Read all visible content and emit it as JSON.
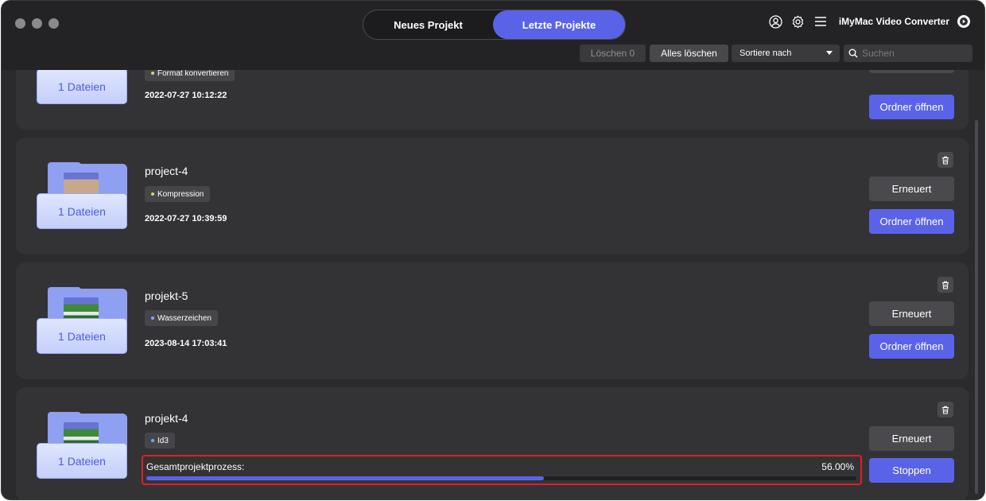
{
  "header": {
    "tabs": [
      {
        "label": "Neues Projekt",
        "active": false
      },
      {
        "label": "Letzte Projekte",
        "active": true
      }
    ],
    "app_name": "iMyMac Video Converter",
    "icons": [
      "user-icon",
      "gear-icon",
      "menu-icon",
      "app-logo-icon"
    ]
  },
  "toolbar": {
    "clear_label": "Löschen 0",
    "clear_all_label": "Alles löschen",
    "sort_label": "Sortiere nach",
    "search_placeholder": "Suchen"
  },
  "colors": {
    "accent": "#5a63e8",
    "highlight_border": "#e01f26",
    "card_bg": "#333335"
  },
  "projects": [
    {
      "files_label": "1 Dateien",
      "tag": "Format konvertieren",
      "date": "2022-07-27 10:12:22",
      "open_label": "Ordner öffnen"
    },
    {
      "name": "project-4",
      "files_label": "1 Dateien",
      "tag": "Kompression",
      "tag_color": "#b6e36b",
      "date": "2022-07-27 10:39:59",
      "renew_label": "Erneuert",
      "open_label": "Ordner öffnen"
    },
    {
      "name": "projekt-5",
      "files_label": "1 Dateien",
      "tag": "Wasserzeichen",
      "tag_color": "#8fa0ff",
      "date": "2023-08-14 17:03:41",
      "renew_label": "Erneuert",
      "open_label": "Ordner öffnen"
    },
    {
      "name": "projekt-4",
      "files_label": "1 Dateien",
      "tag": "Id3",
      "tag_color": "#6fa8ff",
      "renew_label": "Erneuert",
      "stop_label": "Stoppen",
      "progress_label": "Gesamtprojektprozess:",
      "progress_text": "56.00%",
      "progress_value": 0.56
    }
  ]
}
